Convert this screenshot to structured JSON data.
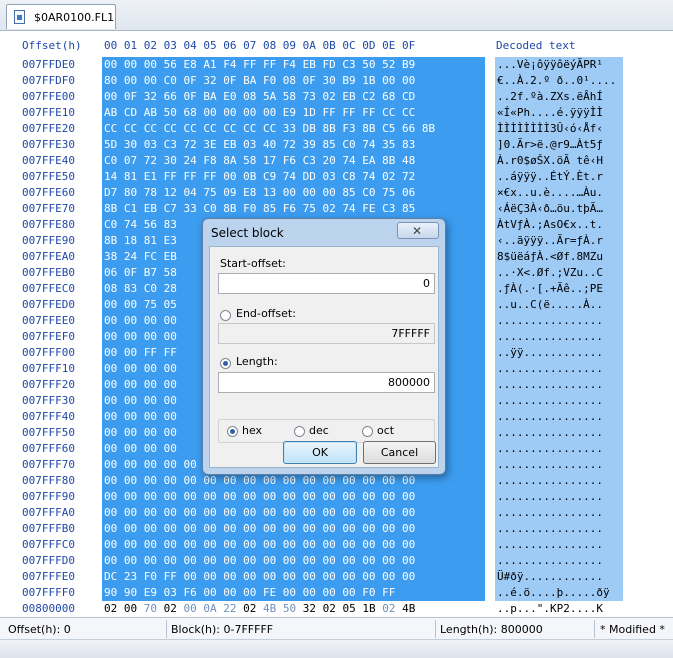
{
  "tab": {
    "title": "$0AR0100.FL1",
    "icon": "document-icon"
  },
  "header": {
    "offset": "Offset(h)",
    "columns": "00 01 02 03 04 05 06 07 08 09 0A 0B 0C 0D 0E 0F",
    "decoded": "Decoded text"
  },
  "rows": {
    "offsets": "007FFDE0\n007FFDF0\n007FFE00\n007FFE10\n007FFE20\n007FFE30\n007FFE40\n007FFE50\n007FFE60\n007FFE70\n007FFE80\n007FFE90\n007FFEA0\n007FFEB0\n007FFEC0\n007FFED0\n007FFEE0\n007FFEF0\n007FFF00\n007FFF10\n007FFF20\n007FFF30\n007FFF40\n007FFF50\n007FFF60\n007FFF70\n007FFF80\n007FFF90\n007FFFA0\n007FFFB0\n007FFFC0\n007FFFD0\n007FFFE0\n007FFFF0",
    "hex": "00 00 00 56 E8 A1 F4 FF FF F4 EB FD C3 50 52 B9\n80 00 00 C0 0F 32 0F BA F0 08 0F 30 B9 1B 00 00\n00 0F 32 66 0F BA E0 08 5A 58 73 02 EB C2 68 CD\nAB CD AB 50 68 00 00 00 00 E9 1D FF FF FF CC CC\nCC CC CC CC CC CC CC CC CC 33 DB 8B F3 8B C5 66 8B\n5D 30 03 C3 72 3E EB 03 40 72 39 85 C0 74 35 83\nC0 07 72 30 24 F8 8A 58 17 F6 C3 20 74 EA 8B 48\n14 81 E1 FF FF FF 00 0B C9 74 DD 03 C8 74 02 72\nD7 80 78 12 04 75 09 E8 13 00 00 00 85 C0 75 06\n8B C1 EB C7 33 C0 8B F0 85 F6 75 02 74 FE C3 85\nC0 74 56 83                         15\n8B 18 81 E3                         14\n38 24 FC EB                         75\n06 0F B7 58                         43\n08 83 C0 28                         45\n00 00 75 05\n00 00 00 00\n00 00 00 00                         19\n00 00 FF FF\n00 00 00 00\n00 00 00 00\n00 00 00 00\n00 00 00 00\n00 00 00 00\n00 00 00 00\n00 00 00 00 00 00 00 00 00 00 00 00 00 00 00 00\n00 00 00 00 00 00 00 00 00 00 00 00 00 00 00 00\n00 00 00 00 00 00 00 00 00 00 00 00 00 00 00 00\n00 00 00 00 00 00 00 00 00 00 00 00 00 00 00 00\n00 00 00 00 00 00 00 00 00 00 00 00 00 00 00 00\n00 00 00 00 00 00 00 00 00 00 00 00 00 00 00 00\n00 00 00 00 00 00 00 00 00 00 00 00 00 00 00 00\nDC 23 F0 FF 00 00 00 00 00 00 00 00 00 00 00 00\n90 90 E9 03 F6 00 00 00 FE 00 00 00 00 F0 FF",
    "decoded": "...Vè¡ôÿÿôëýÃPR¹\n€..À.2.º ð..0¹....\n..2f.ºà.ZXs.ëÂhÍ\n«Í«Ph....é.ÿÿÿÌÌ\nÌÌÌÌÌÌÌÌ3Û‹ó‹Åf‹\n]0.Ãr>ë.@r9…Àt5ƒ\nÀ.r0$øŠX.öÃ tê‹H\n..áÿÿÿ..ÉtÝ.Èt.r\n×€x..u.è....…Àu.\n‹ÁëÇ3À‹ð…öu.tþÃ…\nÀtVƒÀ.;AsO€x..t.\n‹..ãÿÿÿ..Ãr=ƒÀ.r\n8$üëáƒÀ.<Øf.8MZu\n..·X<.Øf.;VZu..C\n.ƒÀ(.·[.+Ãê..;PE\n..u..C(ë.....À..\n................\n................\n..ÿÿ............\n................\n................\n................\n................\n................\n................\n................\n................\n................\n................\n................\n................\n................\nÜ#ðÿ............\n..é.ö....þ.....ðÿ"
  },
  "last_row": {
    "offset": "00800000",
    "hex": "02 00 70 02 00 0A 22 02 4B 50 32 02 05 1B 02 4B",
    "decoded": "..p...\".KP2....K"
  },
  "status": {
    "offset": "Offset(h): 0",
    "block": "Block(h): 0-7FFFFF",
    "length": "Length(h): 800000",
    "modified": "* Modified *"
  },
  "dialog": {
    "title": "Select block",
    "close_icon": "close-icon",
    "start_label": "Start-offset:",
    "start_value": "0",
    "end_label": "End-offset:",
    "end_value": "7FFFFF",
    "length_label": "Length:",
    "length_value": "800000",
    "mode_selected": "length",
    "radix_hex": "hex",
    "radix_dec": "dec",
    "radix_oct": "oct",
    "radix_selected": "hex",
    "ok_label": "OK",
    "cancel_label": "Cancel"
  }
}
